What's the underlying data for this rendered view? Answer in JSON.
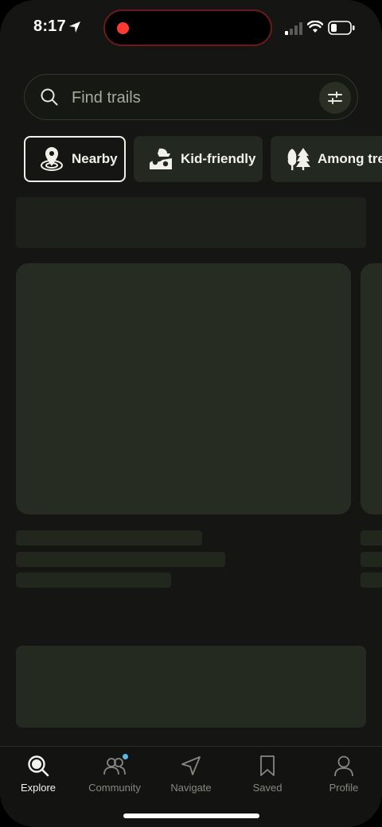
{
  "status": {
    "time": "8:17",
    "recording_color": "#ff3b30"
  },
  "search": {
    "placeholder": "Find trails",
    "value": ""
  },
  "chips": [
    {
      "label": "Nearby",
      "icon": "nearby-pin-icon",
      "active": true
    },
    {
      "label": "Kid-friendly",
      "icon": "kid-friendly-icon",
      "active": false
    },
    {
      "label": "Among trees",
      "icon": "trees-icon",
      "active": false
    }
  ],
  "tabs": [
    {
      "label": "Explore",
      "icon": "search-icon",
      "active": true
    },
    {
      "label": "Community",
      "icon": "community-icon",
      "badge": true
    },
    {
      "label": "Navigate",
      "icon": "navigate-icon"
    },
    {
      "label": "Saved",
      "icon": "bookmark-icon"
    },
    {
      "label": "Profile",
      "icon": "profile-icon"
    }
  ],
  "colors": {
    "background": "#151613",
    "skeleton": "#262c21",
    "chip_background": "#232820",
    "active_text": "#f4f4ee",
    "inactive_text": "#85887e",
    "badge": "#5bb8e6"
  }
}
